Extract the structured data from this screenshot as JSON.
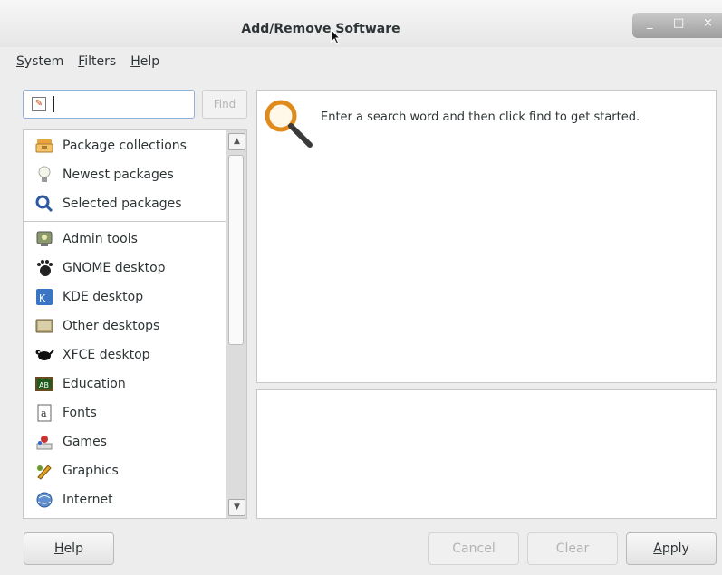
{
  "window": {
    "title": "Add/Remove Software",
    "controls": [
      "_",
      "□",
      "×"
    ]
  },
  "menu": [
    {
      "label": "System",
      "mnemonic": "S"
    },
    {
      "label": "Filters",
      "mnemonic": "F"
    },
    {
      "label": "Help",
      "mnemonic": "H"
    }
  ],
  "search": {
    "value": "",
    "placeholder": "",
    "find_label": "Find"
  },
  "groups": [
    {
      "label": "Package collections",
      "icon": "package-collections-icon"
    },
    {
      "label": "Newest packages",
      "icon": "newest-packages-icon"
    },
    {
      "label": "Selected packages",
      "icon": "selected-packages-icon"
    }
  ],
  "categories": [
    {
      "label": "Admin tools",
      "icon": "admin-tools-icon"
    },
    {
      "label": "GNOME desktop",
      "icon": "gnome-foot-icon"
    },
    {
      "label": "KDE desktop",
      "icon": "kde-icon"
    },
    {
      "label": "Other desktops",
      "icon": "other-desktops-icon"
    },
    {
      "label": "XFCE desktop",
      "icon": "xfce-mouse-icon"
    },
    {
      "label": "Education",
      "icon": "education-icon"
    },
    {
      "label": "Fonts",
      "icon": "fonts-icon"
    },
    {
      "label": "Games",
      "icon": "games-icon"
    },
    {
      "label": "Graphics",
      "icon": "graphics-icon"
    },
    {
      "label": "Internet",
      "icon": "internet-icon"
    }
  ],
  "main": {
    "hint": "Enter a search word and then click find to get started."
  },
  "buttons": {
    "help": "Help",
    "cancel": "Cancel",
    "clear": "Clear",
    "apply": "Apply"
  }
}
